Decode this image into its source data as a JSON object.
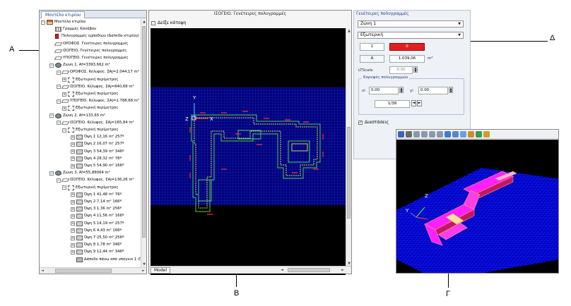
{
  "callouts": {
    "a": "A",
    "b": "B",
    "g": "Γ",
    "d": "Δ"
  },
  "tree": {
    "tab_label": "Μοντέλο κτιρίου",
    "nodes": [
      {
        "pm": "⊟",
        "icon": "house",
        "text": "Μοντέλο κτιρίου"
      },
      {
        "pm": "",
        "icon": "grid",
        "text": "Γραμμές Κανάβου"
      },
      {
        "pm": "",
        "icon": "red",
        "text": "Πολυγραμμές εμποδίων (Δαπεδα κτιρίου)"
      },
      {
        "pm": "",
        "icon": "plane",
        "text": "ΟΡΟΦΟΣ. Γενέτειρες πολυγραμμές"
      },
      {
        "pm": "",
        "icon": "plane",
        "text": "ΙΣΟΓΕΙΟ. Γενέτειρες πολυγραμμές"
      },
      {
        "pm": "",
        "icon": "plane",
        "text": "ΥΠΟΓΕΙΟ. Γενέτειρες πολυγραμμές"
      },
      {
        "pm": "⊟",
        "icon": "zone",
        "text": "Ζώνη 1, Af=3393,662 m²"
      },
      {
        "pm": "⊟",
        "icon": "plane",
        "text": "ΟΡΟΦΟΣ. Κέλυφος. ΣΑj=2.044,17 m²"
      },
      {
        "pm": "⊞",
        "icon": "shell",
        "text": "Εξωτερική περίμετρος"
      },
      {
        "pm": "⊟",
        "icon": "plane",
        "text": "ΙΣΟΓΕΙΟ. Κέλυφος. ΣΑj=840,68 m²"
      },
      {
        "pm": "⊞",
        "icon": "shell",
        "text": "Εξωτερική περίμετρος"
      },
      {
        "pm": "⊟",
        "icon": "plane",
        "text": "ΥΠΟΓΕΙΟ. Κέλυφος. ΣΑj=1.788,68 m²"
      },
      {
        "pm": "⊞",
        "icon": "shell",
        "text": "Εξωτερική περίμετρος"
      },
      {
        "pm": "⊟",
        "icon": "zone",
        "text": "Ζώνη 2, Af=133,65 m²"
      },
      {
        "pm": "⊟",
        "icon": "plane",
        "text": "ΙΣΟΓΕΙΟ. Κέλυφος. ΣΑj=165,84 m²"
      },
      {
        "pm": "⊟",
        "icon": "shell",
        "text": "Εξωτερική περίμετρος"
      },
      {
        "pm": "⊞",
        "icon": "face",
        "text": "Όψη 1 12,16 m² 257º"
      },
      {
        "pm": "⊞",
        "icon": "face",
        "text": "Όψη 2 16,07 m² 257º"
      },
      {
        "pm": "⊞",
        "icon": "face",
        "text": "Όψη 3 54,39 m² 346º"
      },
      {
        "pm": "⊞",
        "icon": "face",
        "text": "Όψη 4 28,32 m² 76º"
      },
      {
        "pm": "⊞",
        "icon": "face",
        "text": "Όψη 5 54,90 m² 166º"
      },
      {
        "pm": "⊟",
        "icon": "zone",
        "text": "Ζώνη 3, Af=55,88064 m²"
      },
      {
        "pm": "⊟",
        "icon": "plane",
        "text": "ΙΣΟΓΕΙΟ. Κέλυφος. ΣΑj=136,26 m²"
      },
      {
        "pm": "⊟",
        "icon": "shell",
        "text": "Εξωτερική περίμετρος"
      },
      {
        "pm": "⊞",
        "icon": "face",
        "text": "Όψη 1 41,48 m² 76º"
      },
      {
        "pm": "⊞",
        "icon": "face",
        "text": "Όψη 2 7,14 m² 166º"
      },
      {
        "pm": "⊞",
        "icon": "face",
        "text": "Όψη 3 1,36 m² 256º"
      },
      {
        "pm": "⊞",
        "icon": "face",
        "text": "Όψη 4 11,56 m² 166º"
      },
      {
        "pm": "⊞",
        "icon": "face",
        "text": "Όψη 5 14,19 m² 257º"
      },
      {
        "pm": "⊞",
        "icon": "face",
        "text": "Όψη 6 4,43 m² 166º"
      },
      {
        "pm": "⊞",
        "icon": "face",
        "text": "Όψη 7 25,50 m² 256º"
      },
      {
        "pm": "⊞",
        "icon": "face",
        "text": "Όψη 8 1,78 m² 346º"
      },
      {
        "pm": "⊞",
        "icon": "face",
        "text": "Όψη 9 12,44 m² 346º"
      },
      {
        "pm": "",
        "icon": "slab",
        "text": "Δάπεδο πάνω από υπόγειο 1 (Π"
      }
    ]
  },
  "plan": {
    "title": "ΙΣΟΓΕΙΟ. Γενέτειρες πολυγραμμές",
    "show_plan_label": "Δείξε κάτοψη",
    "axis_y": "Y",
    "axis_z": "Z",
    "axis_x": "X",
    "model_tab": "Model"
  },
  "props": {
    "title": "Γενέτειρες πολυγραμμές",
    "zone_select": "Ζώνη 1",
    "type_select": "Εξωτερική",
    "index_value": "1",
    "color_value": "0",
    "area_label": "A",
    "area_value": "1.039,06",
    "area_unit": "m²",
    "ltscale_label": "LTScale",
    "ltscale_value": "0.00",
    "vertices_title": "Κορυφές πολυγραμμών",
    "xi_label": "xi",
    "xi_value": "0.00",
    "yi_label": "yi",
    "yi_value": "0.00",
    "vertex_counter": "1/38",
    "dims_label": "Διαστάσεις",
    "accent": "#e02020"
  },
  "view3d": {
    "axis_z": "Z",
    "axis_y": "Y",
    "toolbar_icons": [
      "save-icon",
      "print-icon",
      "view-front-icon",
      "view-back-icon",
      "view-left-icon",
      "view-right-icon",
      "zoom-icon",
      "box-icon",
      "cube-icon",
      "render-icon",
      "layers-icon",
      "color-icon"
    ]
  }
}
